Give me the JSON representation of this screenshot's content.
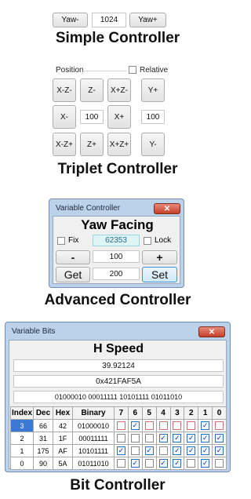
{
  "simple": {
    "yaw_minus": "Yaw-",
    "value": "1024",
    "yaw_plus": "Yaw+",
    "caption": "Simple Controller"
  },
  "triplet": {
    "position_label": "Position",
    "relative_label": "Relative",
    "buttons": [
      "X-Z-",
      "Z-",
      "X+Z-",
      "X-",
      "X+",
      "X-Z+",
      "Z+",
      "X+Z+"
    ],
    "value": "100",
    "y_plus": "Y+",
    "y_value": "100",
    "y_minus": "Y-",
    "caption": "Triplet Controller"
  },
  "advanced": {
    "window_title": "Variable Controller",
    "close": "✕",
    "heading": "Yaw Facing",
    "fix_label": "Fix",
    "lock_label": "Lock",
    "current_value": "62353",
    "minus": "-",
    "step": "100",
    "plus": "+",
    "get": "Get",
    "set_value": "200",
    "set": "Set",
    "caption": "Advanced Controller"
  },
  "bits": {
    "window_title": "Variable Bits",
    "close": "✕",
    "heading": "H Speed",
    "float_value": "39.92124",
    "hex_value": "0x421FAF5A",
    "binary_value": "01000010 00011111 10101111 01011010",
    "columns": [
      "Index",
      "Dec",
      "Hex",
      "Binary",
      "7",
      "6",
      "5",
      "4",
      "3",
      "2",
      "1",
      "0"
    ],
    "rows": [
      {
        "index": "3",
        "dec": "66",
        "hex": "42",
        "bin": "01000010"
      },
      {
        "index": "2",
        "dec": "31",
        "hex": "1F",
        "bin": "00011111"
      },
      {
        "index": "1",
        "dec": "175",
        "hex": "AF",
        "bin": "10101111"
      },
      {
        "index": "0",
        "dec": "90",
        "hex": "5A",
        "bin": "01011010"
      }
    ],
    "caption": "Bit Controller"
  }
}
